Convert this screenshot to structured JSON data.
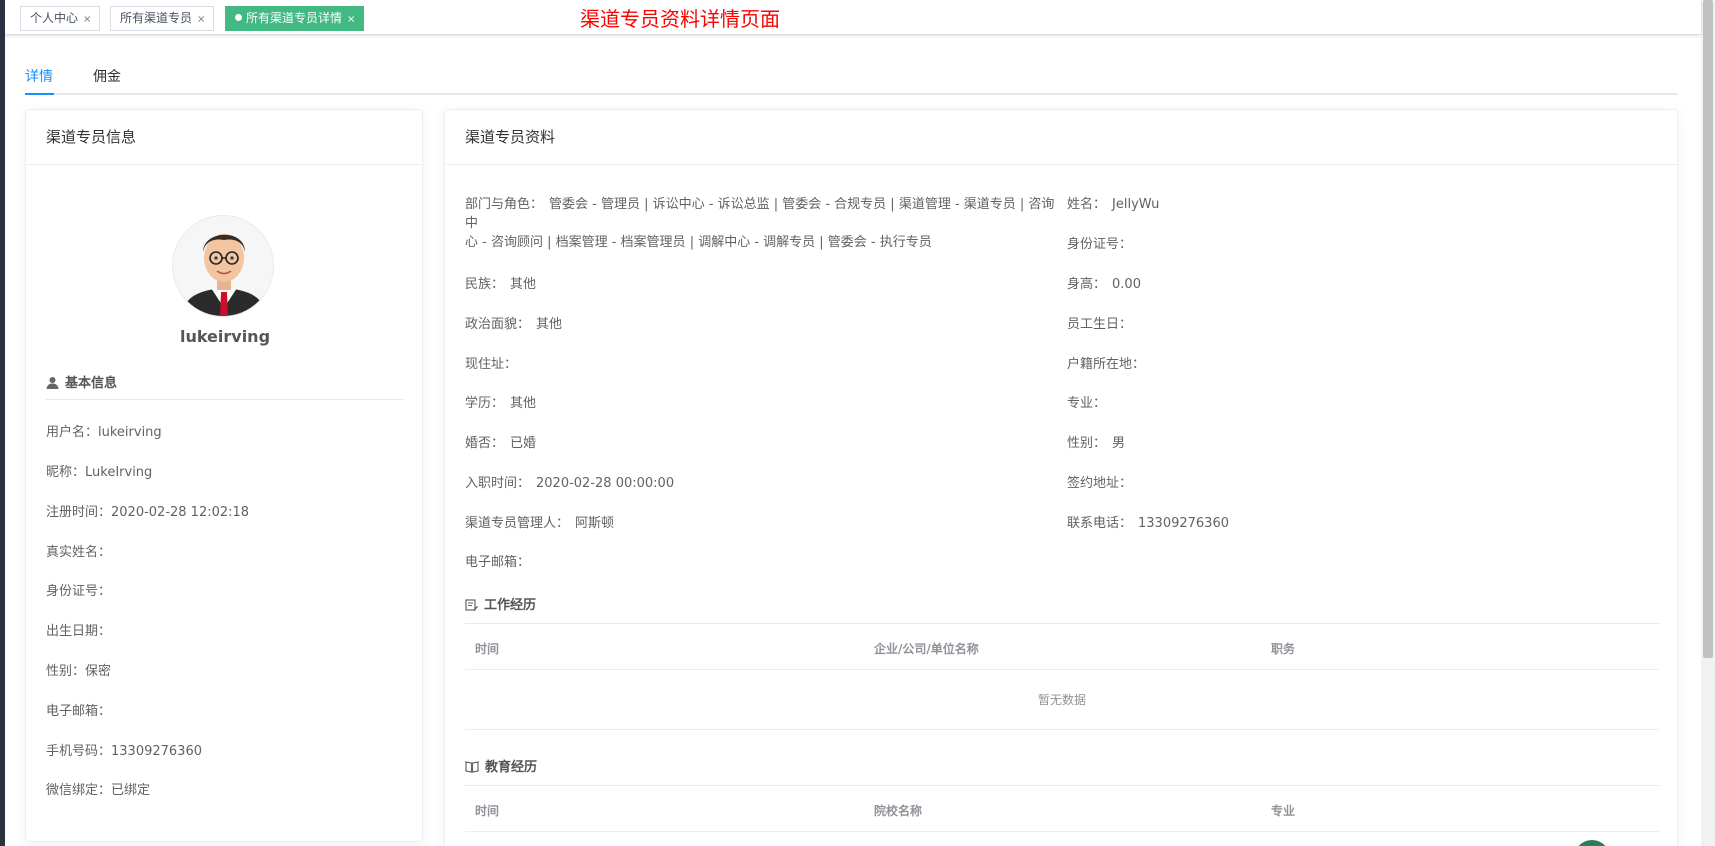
{
  "tags": [
    {
      "label": "个人中心",
      "close": "×"
    },
    {
      "label": "所有渠道专员",
      "close": "×"
    },
    {
      "label": "所有渠道专员详情",
      "close": "×"
    }
  ],
  "annotation": "渠道专员资料详情页面",
  "tabs": [
    "详情",
    "佣金"
  ],
  "left_card": {
    "title": "渠道专员信息",
    "username": "lukeirving",
    "section": "基本信息",
    "rows": [
      "用户名：lukeirving",
      "昵称：LukeIrving",
      "注册时间：2020-02-28 12:02:18",
      "真实姓名：",
      "身份证号：",
      "出生日期：",
      "性别：保密",
      "电子邮箱：",
      "手机号码：13309276360",
      "微信绑定：已绑定"
    ]
  },
  "right_card": {
    "title": "渠道专员资料",
    "dept_label": "部门与角色：",
    "dept_value_line1": "管委会 - 管理员 | 诉讼中心 - 诉讼总监 | 管委会 - 合规专员 | 渠道管理 - 渠道专员 | 咨询中",
    "dept_value_line2": "心 - 咨询顾问 | 档案管理 - 档案管理员 | 调解中心 - 调解专员 | 管委会 - 执行专员",
    "left_fields": [
      {
        "k": "民族：",
        "v": "其他"
      },
      {
        "k": "政治面貌：",
        "v": "其他"
      },
      {
        "k": "现住址：",
        "v": ""
      },
      {
        "k": "学历：",
        "v": "其他"
      },
      {
        "k": "婚否：",
        "v": "已婚"
      },
      {
        "k": "入职时间：",
        "v": "2020-02-28 00:00:00"
      },
      {
        "k": "渠道专员管理人：",
        "v": "阿斯顿"
      },
      {
        "k": "电子邮箱：",
        "v": ""
      }
    ],
    "right_fields": [
      {
        "k": "姓名：",
        "v": "JellyWu"
      },
      {
        "k": "身份证号：",
        "v": ""
      },
      {
        "k": "身高：",
        "v": "0.00"
      },
      {
        "k": "员工生日：",
        "v": ""
      },
      {
        "k": "户籍所在地：",
        "v": ""
      },
      {
        "k": "专业：",
        "v": ""
      },
      {
        "k": "性别：",
        "v": "男"
      },
      {
        "k": "签约地址：",
        "v": ""
      },
      {
        "k": "联系电话：",
        "v": "13309276360"
      }
    ],
    "work": {
      "title": "工作经历",
      "columns": [
        "时间",
        "企业/公司/单位名称",
        "职务"
      ],
      "empty": "暂无数据"
    },
    "edu": {
      "title": "教育经历",
      "columns": [
        "时间",
        "院校名称",
        "专业"
      ]
    }
  },
  "colors": {
    "accent": "#1890ff",
    "tag_active": "#42b983",
    "annotation": "#ff0000"
  }
}
